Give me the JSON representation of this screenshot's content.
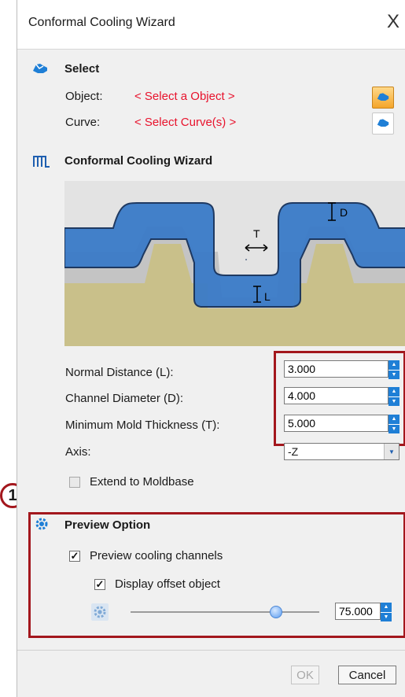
{
  "window": {
    "title": "Conformal Cooling Wizard",
    "close_label": "X"
  },
  "select_section": {
    "title": "Select",
    "object_label": "Object:",
    "object_value": "< Select a Object >",
    "curve_label": "Curve:",
    "curve_value": "< Select Curve(s) >"
  },
  "wizard_section": {
    "title": "Conformal Cooling Wizard",
    "diagram_labels": {
      "d": "D",
      "t": "T",
      "l": "L"
    }
  },
  "parameters": {
    "normal_distance": {
      "label": "Normal Distance (L):",
      "value": "3.000"
    },
    "channel_diameter": {
      "label": "Channel Diameter (D):",
      "value": "4.000"
    },
    "min_mold_thickness": {
      "label": "Minimum Mold Thickness (T):",
      "value": "5.000"
    },
    "axis": {
      "label": "Axis:",
      "value": "-Z"
    },
    "extend_to_moldbase": {
      "label": "Extend to Moldbase",
      "checked": false
    }
  },
  "preview": {
    "title": "Preview Option",
    "preview_channels": {
      "label": "Preview cooling channels",
      "checked": true
    },
    "display_offset": {
      "label": "Display offset object",
      "checked": true
    },
    "slider_fraction": 0.77,
    "slider_value": "75.000"
  },
  "footer": {
    "ok_label": "OK",
    "cancel_label": "Cancel"
  },
  "callout_number": "1",
  "colors": {
    "accent": "#1f7fd6",
    "highlight_box": "#a3171d",
    "select_prompt": "#e8122c",
    "channel": "#3a7bc8",
    "mold": "#c9c08a"
  }
}
